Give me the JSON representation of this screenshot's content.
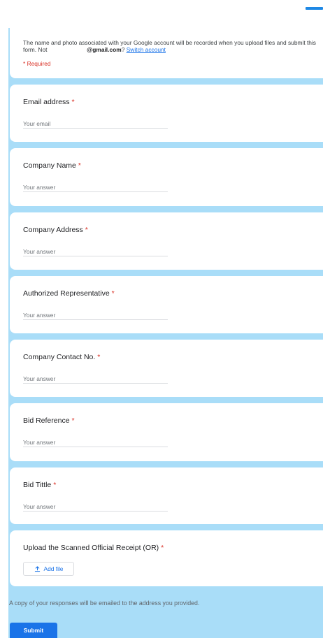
{
  "header": {
    "notice_prefix": "The name and photo associated with your Google account will be recorded when you upload files and submit this form. Not",
    "account_email": "@gmail.com",
    "question_mark": "?",
    "switch_account_label": "Switch account",
    "required_note": "* Required"
  },
  "questions": [
    {
      "title": "Email address",
      "placeholder": "Your email"
    },
    {
      "title": "Company Name",
      "placeholder": "Your answer"
    },
    {
      "title": "Company Address",
      "placeholder": "Your answer"
    },
    {
      "title": "Authorized Representative",
      "placeholder": "Your answer"
    },
    {
      "title": "Company Contact No.",
      "placeholder": "Your answer"
    },
    {
      "title": "Bid Reference",
      "placeholder": "Your answer"
    },
    {
      "title": "Bid Tittle",
      "placeholder": "Your answer"
    }
  ],
  "upload": {
    "title": "Upload the Scanned Official Receipt (OR)",
    "button_label": "Add file"
  },
  "required_marker": "*",
  "footer": {
    "copy_note": "A copy of your responses will be emailed to the address you provided.",
    "submit_label": "Submit"
  },
  "colors": {
    "background": "#a9ddf8",
    "accent": "#1a73e8",
    "required": "#d93025"
  }
}
